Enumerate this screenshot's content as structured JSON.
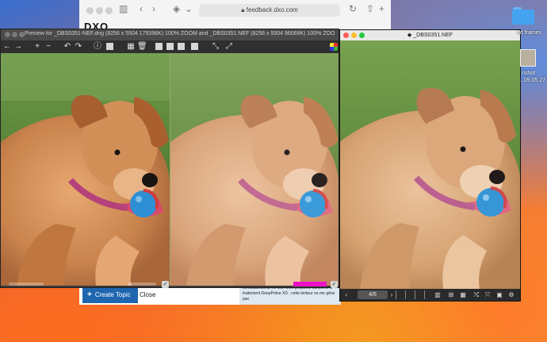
{
  "browser": {
    "address": "feedback.dxo.com",
    "logo": "DXO"
  },
  "forum": {
    "create_topic_label": "Create Topic",
    "close_label": "Close",
    "snippet": "contributeurs de ce site. Mon problème concerne le traitement DeepPrime XD : cette lenteur ne me gêne pas"
  },
  "preview": {
    "title": "Preview for _DBS0351-NEF.dng (8256 x 5504 179396K) 100% ZOOM and _DBS0351.NEF (8256 x 5504 96069K) 100% ZOOM (..."
  },
  "viewer": {
    "title": "_DBS0351.NEF",
    "page_counter": "4/6"
  },
  "desktop": {
    "folder_label": "ed frames",
    "screenshot_label_1": "nshot",
    "screenshot_label_2": "...09.05.27"
  },
  "colors": {
    "create_topic": "#1f66b0",
    "magenta_marker": "#ee10c8",
    "folder": "#45a2ee"
  },
  "icons": {
    "toolbar": [
      "arrow-left-icon",
      "arrow-right-icon",
      "zoom-in-icon",
      "zoom-out-icon",
      "rotate-left-icon",
      "rotate-right-icon",
      "info-icon",
      "crop-icon",
      "grid-icon",
      "delete-icon",
      "single-view-icon",
      "split-view-icon",
      "compare-view-icon",
      "layout-icon",
      "expand-icon",
      "fullscreen-icon",
      "color-icon"
    ],
    "viewer": [
      "prev-icon",
      "next-icon",
      "view-single-icon",
      "view-grid-icon",
      "view-list-icon",
      "shuffle-icon",
      "rotate-icon",
      "image-icon",
      "slideshow-icon",
      "settings-icon"
    ]
  }
}
